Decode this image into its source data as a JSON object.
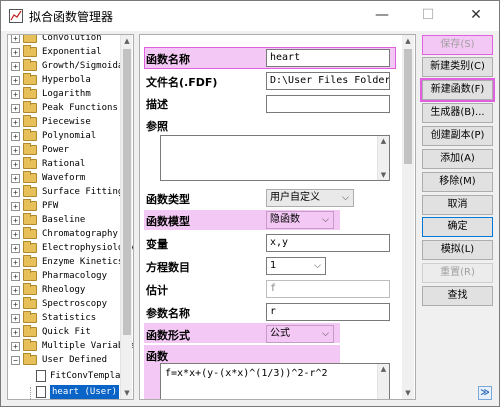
{
  "window": {
    "title": "拟合函数管理器",
    "min": "—",
    "max": "☐",
    "close": "✕"
  },
  "tree": {
    "items": [
      "Convolution",
      "Exponential",
      "Growth/Sigmoidal",
      "Hyperbola",
      "Logarithm",
      "Peak Functions",
      "Piecewise",
      "Polynomial",
      "Power",
      "Rational",
      "Waveform",
      "Surface Fitting",
      "PFW",
      "Baseline",
      "Chromatography",
      "Electrophysiology",
      "Enzyme Kinetics",
      "Pharmacology",
      "Rheology",
      "Spectroscopy",
      "Statistics",
      "Quick Fit",
      "Multiple Variables",
      "User Defined"
    ],
    "children": [
      "FitConvTemplate",
      "heart (User)"
    ],
    "collapsed_mark": "+",
    "expanded_mark": "−"
  },
  "form": {
    "func_name_label": "函数名称",
    "func_name_value": "heart",
    "file_name_label": "文件名(.FDF)",
    "file_name_value": "D:\\User Files Folder\\",
    "brief_label": "描述",
    "brief_value": "",
    "params_label": "参照",
    "func_type_label": "函数类型",
    "func_type_value": "用户自定义",
    "func_model_label": "函数模型",
    "func_model_value": "隐函数",
    "variables_label": "变量",
    "variables_value": "x,y",
    "equations_label": "方程数目",
    "equations_value": "1",
    "estimate_label": "估计",
    "estimate_value": "f",
    "param_names_label": "参数名称",
    "param_names_value": "r",
    "func_form_label": "函数形式",
    "func_form_value": "公式",
    "function_label": "函数",
    "function_value": "f=x*x+(y-(x*x)^(1/3))^2-r^2"
  },
  "buttons": {
    "save": "保存(S)",
    "new_category": "新建类别(C)",
    "new_function": "新建函数(F)",
    "generator": "生成器(B)...",
    "duplicate": "创建副本(P)",
    "add": "添加(A)",
    "remove": "移除(M)",
    "cancel": "取消",
    "ok": "确定",
    "simulate": "模拟(L)",
    "reset": "重置(R)",
    "find": "查找",
    "collapse": "≫"
  },
  "colors": {
    "highlight": "#f4c8f4",
    "highlight_border": "#e060e0",
    "selection": "#0a64c8",
    "folder": "#e8c05a"
  }
}
